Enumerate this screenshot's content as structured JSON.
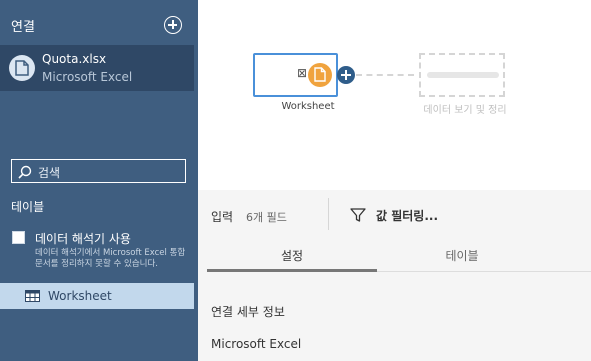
{
  "sidebar": {
    "title": "연결",
    "connection": {
      "name": "Quota.xlsx",
      "type": "Microsoft Excel"
    },
    "search": {
      "placeholder": "검색"
    },
    "section": "테이블",
    "interpreter": {
      "label": "데이터 해석기 사용",
      "description": "데이터 해석기에서 Microsoft Excel 통합 문서를 정리하지 못할 수 있습니다.",
      "checked": false
    },
    "tables": [
      {
        "name": "Worksheet",
        "icon": "table-grid-icon"
      }
    ]
  },
  "canvas": {
    "node": {
      "label": "Worksheet",
      "icon": "excel-file-icon",
      "badge_color": "#f0a33e"
    },
    "ghost_label": "데이터 보기 및 정리"
  },
  "panel": {
    "input_label": "입력",
    "field_count": "6개 필드",
    "filter_label": "값 필터링...",
    "tabs": [
      {
        "label": "설정",
        "active": true
      },
      {
        "label": "테이블",
        "active": false
      }
    ],
    "section_title": "연결 세부 정보",
    "connection_type": "Microsoft Excel"
  },
  "colors": {
    "sidebar_bg": "#3f5e80",
    "selected_connection_bg": "#2f4866",
    "selected_table_bg": "#c2d8ec",
    "node_border": "#4a90d9",
    "add_button": "#2f5d8a"
  }
}
